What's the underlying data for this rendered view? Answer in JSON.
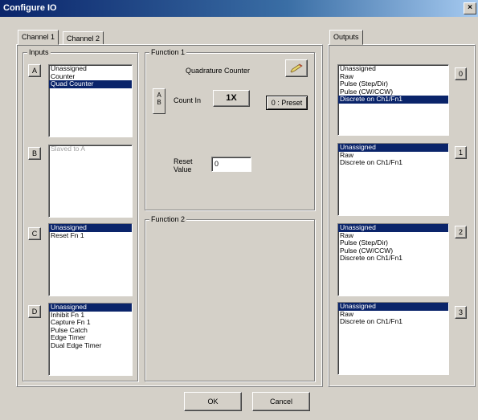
{
  "window": {
    "title": "Configure IO",
    "close_glyph": "×"
  },
  "tabs": {
    "channel1": "Channel 1",
    "channel2": "Channel 2",
    "outputs": "Outputs"
  },
  "inputs": {
    "legend": "Inputs",
    "groups": [
      {
        "letter": "A",
        "items": [
          {
            "text": "Unassigned",
            "selected": false
          },
          {
            "text": "Counter",
            "selected": false
          },
          {
            "text": "Quad Counter",
            "selected": true
          }
        ]
      },
      {
        "letter": "B",
        "disabled": true,
        "items": [
          {
            "text": "Slaved to A",
            "selected": false
          }
        ]
      },
      {
        "letter": "C",
        "items": [
          {
            "text": "Unassigned",
            "selected": true
          },
          {
            "text": "Reset Fn 1",
            "selected": false
          }
        ]
      },
      {
        "letter": "D",
        "items": [
          {
            "text": "Unassigned",
            "selected": true
          },
          {
            "text": "Inhibit Fn 1",
            "selected": false
          },
          {
            "text": "Capture Fn 1",
            "selected": false
          },
          {
            "text": "Pulse Catch",
            "selected": false
          },
          {
            "text": "Edge Timer",
            "selected": false
          },
          {
            "text": "Dual Edge Timer",
            "selected": false
          }
        ]
      }
    ]
  },
  "function1": {
    "legend": "Function 1",
    "mode": "Quadrature Counter",
    "ab_label_a": "A",
    "ab_label_b": "B",
    "count_in_label": "Count In",
    "count_in_value": "1X",
    "preset_button": "0 : Preset",
    "reset_label_1": "Reset",
    "reset_label_2": "Value",
    "reset_value": "0"
  },
  "function2": {
    "legend": "Function 2"
  },
  "outputs": {
    "groups": [
      {
        "number": "0",
        "items": [
          {
            "text": "Unassigned",
            "selected": false
          },
          {
            "text": "Raw",
            "selected": false
          },
          {
            "text": "Pulse (Step/Dir)",
            "selected": false
          },
          {
            "text": "Pulse (CW/CCW)",
            "selected": false
          },
          {
            "text": "Discrete on Ch1/Fn1",
            "selected": true
          }
        ]
      },
      {
        "number": "1",
        "items": [
          {
            "text": "Unassigned",
            "selected": true
          },
          {
            "text": "Raw",
            "selected": false
          },
          {
            "text": "Discrete on Ch1/Fn1",
            "selected": false
          }
        ]
      },
      {
        "number": "2",
        "items": [
          {
            "text": "Unassigned",
            "selected": true
          },
          {
            "text": "Raw",
            "selected": false
          },
          {
            "text": "Pulse (Step/Dir)",
            "selected": false
          },
          {
            "text": "Pulse (CW/CCW)",
            "selected": false
          },
          {
            "text": "Discrete on Ch1/Fn1",
            "selected": false
          }
        ]
      },
      {
        "number": "3",
        "items": [
          {
            "text": "Unassigned",
            "selected": true
          },
          {
            "text": "Raw",
            "selected": false
          },
          {
            "text": "Discrete on Ch1/Fn1",
            "selected": false
          }
        ]
      }
    ]
  },
  "footer": {
    "ok": "OK",
    "cancel": "Cancel"
  }
}
